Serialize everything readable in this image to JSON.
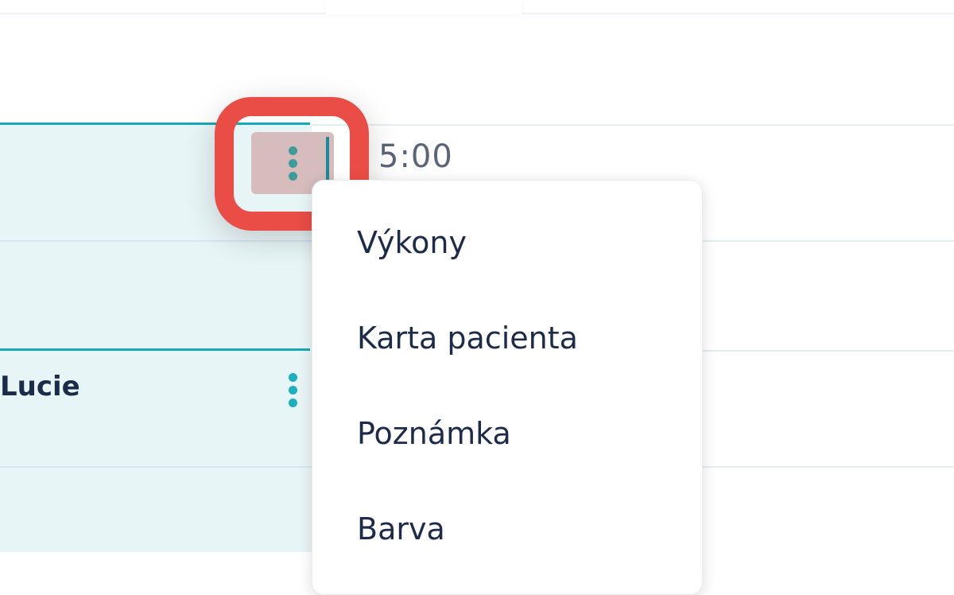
{
  "appointment": {
    "time": "5:00",
    "patient_name": "Lucie"
  },
  "menu": {
    "items": [
      {
        "label": "Výkony"
      },
      {
        "label": "Karta pacienta"
      },
      {
        "label": "Poznámka"
      },
      {
        "label": "Barva"
      }
    ]
  },
  "icons": {
    "more": "kebab-vertical-icon"
  },
  "colors": {
    "accent": "#18a8b8",
    "appointment_bg": "#e8f5f7",
    "highlight": "#e94d45",
    "text_dark": "#1c2b4a"
  }
}
